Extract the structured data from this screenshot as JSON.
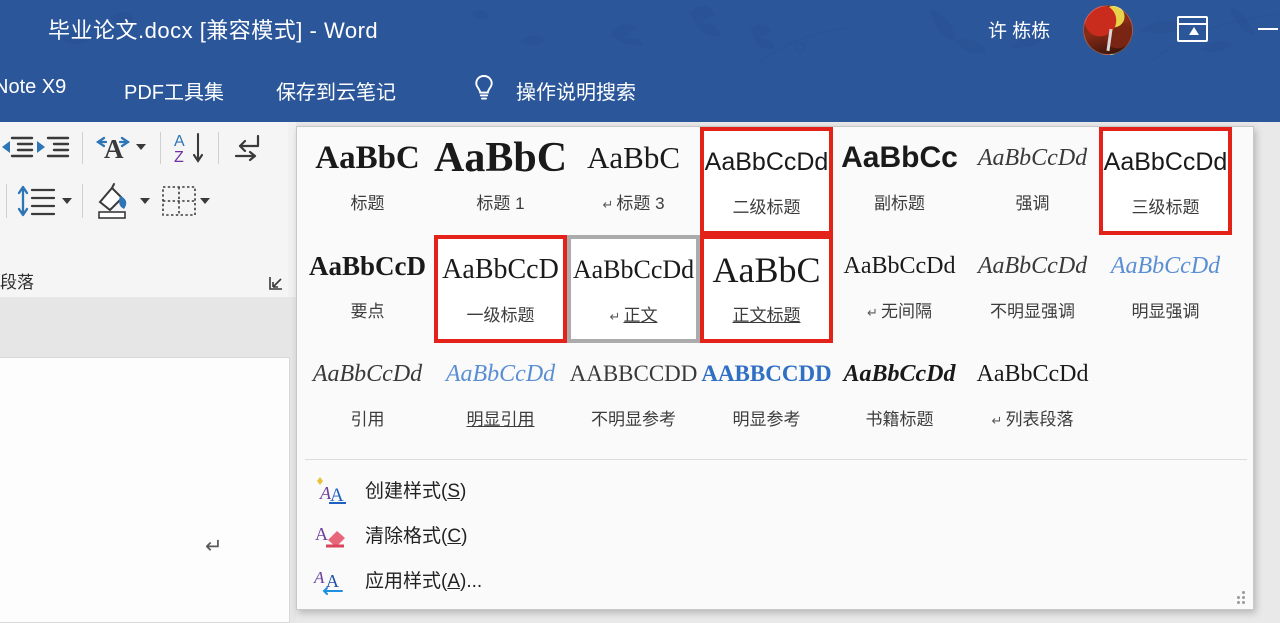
{
  "window": {
    "title": "毕业论文.docx [兼容模式]  -  Word",
    "user_name": "许 栋栋",
    "accent_color": "#2B579A",
    "avatar_name": "avatar",
    "ribbon_display_options": "功能区显示选项",
    "minimize": "最小化"
  },
  "tabs": [
    {
      "label": "Note X9",
      "name": "tab-endnote"
    },
    {
      "label": "PDF工具集",
      "name": "tab-pdf"
    },
    {
      "label": "保存到云笔记",
      "name": "tab-cloudnote"
    },
    {
      "label": "操作说明搜索",
      "name": "tab-tellme"
    }
  ],
  "ribbon": {
    "group_label": "段落",
    "dialog_launcher": "段落设置",
    "buttons": [
      {
        "name": "decrease-indent-icon",
        "label": "减少缩进量"
      },
      {
        "name": "increase-indent-icon",
        "label": "增加缩进量"
      },
      {
        "name": "text-direction-icon",
        "label": "中文版式"
      },
      {
        "name": "sort-az-icon",
        "label": "排序"
      },
      {
        "name": "show-formatting-marks-icon",
        "label": "显示/隐藏编辑标记"
      },
      {
        "name": "line-spacing-icon",
        "label": "行和段落间距"
      },
      {
        "name": "shading-icon",
        "label": "底纹"
      },
      {
        "name": "borders-icon",
        "label": "边框"
      }
    ]
  },
  "document": {
    "paragraph_mark": "↵"
  },
  "styles_gallery": {
    "rows": [
      [
        {
          "preview": "AaBbC",
          "name": "标题",
          "pilcrow": false,
          "weight": "bold",
          "style": "normal",
          "size": 33,
          "color": "#1a1a1a",
          "underline": false,
          "highlight": "none"
        },
        {
          "preview": "AaBbC",
          "name": "标题 1",
          "pilcrow": false,
          "weight": "bold",
          "style": "normal",
          "size": 42,
          "color": "#1a1a1a",
          "underline": false,
          "highlight": "none"
        },
        {
          "preview": "AaBbC",
          "name": "标题 3",
          "pilcrow": true,
          "weight": "normal",
          "style": "normal",
          "size": 31,
          "color": "#1a1a1a",
          "underline": false,
          "highlight": "none"
        },
        {
          "preview": "AaBbCcDd",
          "name": "二级标题",
          "pilcrow": false,
          "weight": "normal",
          "style": "normal",
          "size": 25,
          "color": "#1a1a1a",
          "underline": false,
          "highlight": "red",
          "sans": true
        },
        {
          "preview": "AaBbCc",
          "name": "副标题",
          "pilcrow": false,
          "weight": "bold",
          "style": "normal",
          "size": 30,
          "color": "#1a1a1a",
          "underline": false,
          "highlight": "none",
          "sans": true
        },
        {
          "preview": "AaBbCcDd",
          "name": "强调",
          "pilcrow": false,
          "weight": "normal",
          "style": "italic",
          "size": 24,
          "color": "#3a3a3a",
          "underline": false,
          "highlight": "none"
        },
        {
          "preview": "AaBbCcDd",
          "name": "三级标题",
          "pilcrow": false,
          "weight": "normal",
          "style": "normal",
          "size": 25,
          "color": "#1a1a1a",
          "underline": false,
          "highlight": "red",
          "sans": true
        }
      ],
      [
        {
          "preview": "AaBbCcD",
          "name": "要点",
          "pilcrow": false,
          "weight": "bold",
          "style": "normal",
          "size": 27,
          "color": "#1a1a1a",
          "underline": false,
          "highlight": "none"
        },
        {
          "preview": "AaBbCcD",
          "name": "一级标题",
          "pilcrow": false,
          "weight": "normal",
          "style": "normal",
          "size": 28,
          "color": "#1a1a1a",
          "underline": false,
          "highlight": "red"
        },
        {
          "preview": "AaBbCcDd",
          "name": "正文",
          "pilcrow": true,
          "weight": "normal",
          "style": "normal",
          "size": 26,
          "color": "#1a1a1a",
          "underline": true,
          "highlight": "gray"
        },
        {
          "preview": "AaBbC",
          "name": "正文标题",
          "pilcrow": false,
          "weight": "normal",
          "style": "normal",
          "size": 36,
          "color": "#1a1a1a",
          "underline": true,
          "highlight": "red"
        },
        {
          "preview": "AaBbCcDd",
          "name": "无间隔",
          "pilcrow": true,
          "weight": "normal",
          "style": "normal",
          "size": 24,
          "color": "#1a1a1a",
          "underline": false,
          "highlight": "none"
        },
        {
          "preview": "AaBbCcDd",
          "name": "不明显强调",
          "pilcrow": false,
          "weight": "normal",
          "style": "italic",
          "size": 24,
          "color": "#3a3a3a",
          "underline": false,
          "highlight": "none"
        },
        {
          "preview": "AaBbCcDd",
          "name": "明显强调",
          "pilcrow": false,
          "weight": "normal",
          "style": "italic",
          "size": 24,
          "color": "#5B8FD4",
          "underline": false,
          "highlight": "none"
        }
      ],
      [
        {
          "preview": "AaBbCcDd",
          "name": "引用",
          "pilcrow": false,
          "weight": "normal",
          "style": "italic",
          "size": 24,
          "color": "#3a3a3a",
          "underline": false,
          "highlight": "none"
        },
        {
          "preview": "AaBbCcDd",
          "name": "明显引用",
          "pilcrow": false,
          "weight": "normal",
          "style": "italic",
          "size": 24,
          "color": "#5B8FD4",
          "underline": true,
          "highlight": "none"
        },
        {
          "preview": "AABBCCDD",
          "name": "不明显参考",
          "pilcrow": false,
          "weight": "normal",
          "style": "normal",
          "size": 23,
          "color": "#3a3a3a",
          "underline": false,
          "highlight": "none",
          "smallcaps": true
        },
        {
          "preview": "AABBCCDD",
          "name": "明显参考",
          "pilcrow": false,
          "weight": "bold",
          "style": "normal",
          "size": 23,
          "color": "#2F6FC4",
          "underline": false,
          "highlight": "none",
          "smallcaps": true
        },
        {
          "preview": "AaBbCcDd",
          "name": "书籍标题",
          "pilcrow": false,
          "weight": "bold",
          "style": "italic",
          "size": 24,
          "color": "#1a1a1a",
          "underline": false,
          "highlight": "none"
        },
        {
          "preview": "AaBbCcDd",
          "name": "列表段落",
          "pilcrow": true,
          "weight": "normal",
          "style": "normal",
          "size": 24,
          "color": "#1a1a1a",
          "underline": false,
          "highlight": "none"
        }
      ]
    ],
    "menu": [
      {
        "label_pre": "创建样式(",
        "accel": "S",
        "label_post": ")",
        "icon": "create-style-icon"
      },
      {
        "label_pre": "清除格式(",
        "accel": "C",
        "label_post": ")",
        "icon": "clear-formatting-icon"
      },
      {
        "label_pre": "应用样式(",
        "accel": "A",
        "label_post": ")...",
        "icon": "apply-styles-icon"
      }
    ],
    "selected_style": "正文",
    "highlight_color": "#E32219",
    "selection_border_color": "#ABABAB"
  }
}
